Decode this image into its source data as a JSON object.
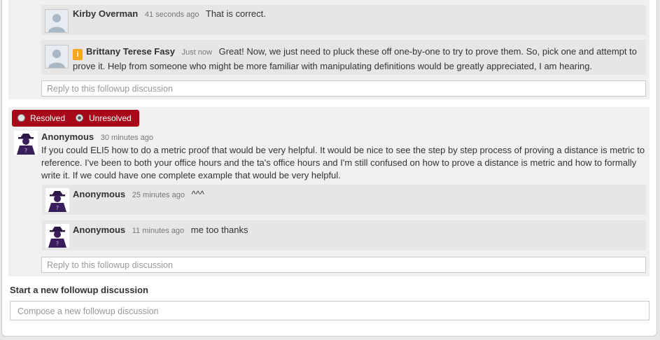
{
  "thread1": {
    "replies": [
      {
        "author": "Kirby Overman",
        "time": "41 seconds ago",
        "text": "That is correct.",
        "instructor": false
      },
      {
        "author": "Brittany Terese Fasy",
        "time": "Just now",
        "text": "Great!  Now, we just need to pluck these off one-by-one to try to prove them.  So, pick one and attempt to prove it.  Help from someone who might be more familiar with manipulating definitions would be greatly appreciated, I am hearing.",
        "instructor": true,
        "badge": "i"
      }
    ],
    "reply_placeholder": "Reply to this followup discussion"
  },
  "thread2": {
    "resolved_label": "Resolved",
    "unresolved_label": "Unresolved",
    "selected": "Unresolved",
    "author": "Anonymous",
    "time": "30 minutes ago",
    "text": "If you could ELI5 how to do a metric proof that would be very helpful. It would be nice to see the step by step process of proving a distance is metric to reference. I've been to both your office hours and the ta's office hours and I'm still confused on how to prove a distance is metric and how to formally write it. If we could have one complete example that would be very helpful.",
    "replies": [
      {
        "author": "Anonymous",
        "time": "25 minutes ago",
        "text": "^^^"
      },
      {
        "author": "Anonymous",
        "time": "11 minutes ago",
        "text": "me too thanks"
      }
    ],
    "reply_placeholder": "Reply to this followup discussion"
  },
  "new_followup": {
    "title": "Start a new followup discussion",
    "placeholder": "Compose a new followup discussion"
  },
  "colors": {
    "resolve_bar": "#a7091a",
    "instructor_badge": "#f2a71e",
    "anon_avatar": "#3a1e5c"
  },
  "icons": {
    "user_avatar": "generic-user-silhouette",
    "anon_avatar": "anonymous-spy-figure"
  }
}
